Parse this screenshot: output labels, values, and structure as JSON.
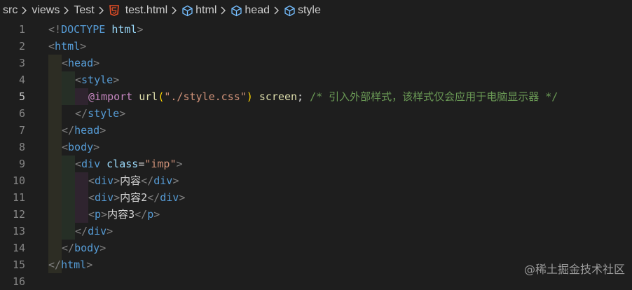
{
  "breadcrumb": {
    "items": [
      "src",
      "views",
      "Test",
      "test.html",
      "html",
      "head",
      "style"
    ]
  },
  "editor": {
    "active_line": 5,
    "line_numbers": [
      "1",
      "2",
      "3",
      "4",
      "5",
      "6",
      "7",
      "8",
      "9",
      "10",
      "11",
      "12",
      "13",
      "14",
      "15",
      "16"
    ],
    "lines": {
      "l1": {
        "open": "<!",
        "kw": "DOCTYPE",
        "space": " ",
        "name": "html",
        "close": ">"
      },
      "l2": {
        "open": "<",
        "tag": "html",
        "close": ">"
      },
      "l3": {
        "open": "<",
        "tag": "head",
        "close": ">"
      },
      "l4": {
        "open": "<",
        "tag": "style",
        "close": ">"
      },
      "l5": {
        "at": "@import",
        "fn": "url",
        "paren_open": "(",
        "str": "\"./style.css\"",
        "paren_close": ")",
        "media": " screen",
        "semi": ";",
        "comment": "/* 引入外部样式，该样式仅会应用于电脑显示器 */"
      },
      "l6": {
        "open": "</",
        "tag": "style",
        "close": ">"
      },
      "l7": {
        "open": "</",
        "tag": "head",
        "close": ">"
      },
      "l8": {
        "open": "<",
        "tag": "body",
        "close": ">"
      },
      "l9": {
        "open": "<",
        "tag": "div",
        "attr": "class",
        "eq": "=",
        "val": "\"imp\"",
        "close": ">"
      },
      "l10": {
        "tag": "div",
        "text": "内容"
      },
      "l11": {
        "tag": "div",
        "text": "内容2"
      },
      "l12": {
        "tag": "p",
        "text": "内容3"
      },
      "l13": {
        "open": "</",
        "tag": "div",
        "close": ">"
      },
      "l14": {
        "open": "</",
        "tag": "body",
        "close": ">"
      },
      "l15": {
        "open": "</",
        "tag": "html",
        "close": ">"
      }
    }
  },
  "watermark": "@稀土掘金技术社区",
  "colors": {
    "background": "#1e1e1e",
    "tag": "#569cd6",
    "attribute": "#9cdcfe",
    "string": "#ce9178",
    "comment": "#6a9955",
    "function": "#dcdcaa",
    "at_rule": "#c586c0",
    "html5_icon": "#e44d26"
  },
  "icons": [
    "chevron-right-icon",
    "html5-icon",
    "symbol-structure-icon"
  ]
}
